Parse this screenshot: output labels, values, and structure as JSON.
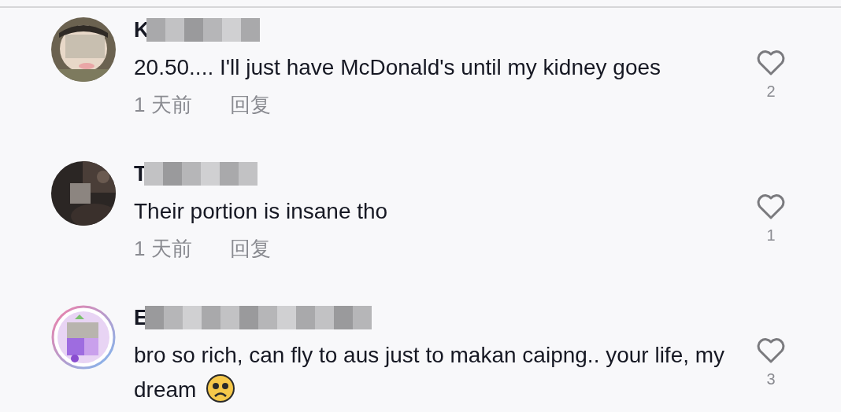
{
  "comments": [
    {
      "username": "K",
      "text": "20.50.... I'll just have McDonald's until my kidney goes",
      "time": "1 天前",
      "reply": "回复",
      "likes": "2",
      "liked": false
    },
    {
      "username": "T",
      "text": "Their portion is insane tho",
      "time": "1 天前",
      "reply": "回复",
      "likes": "1",
      "liked": false
    },
    {
      "username": "E",
      "text": "bro so rich, can fly to aus just to makan caipng.. your life, my dream",
      "trailing_emoji": true,
      "likes": "3",
      "liked": false
    }
  ]
}
